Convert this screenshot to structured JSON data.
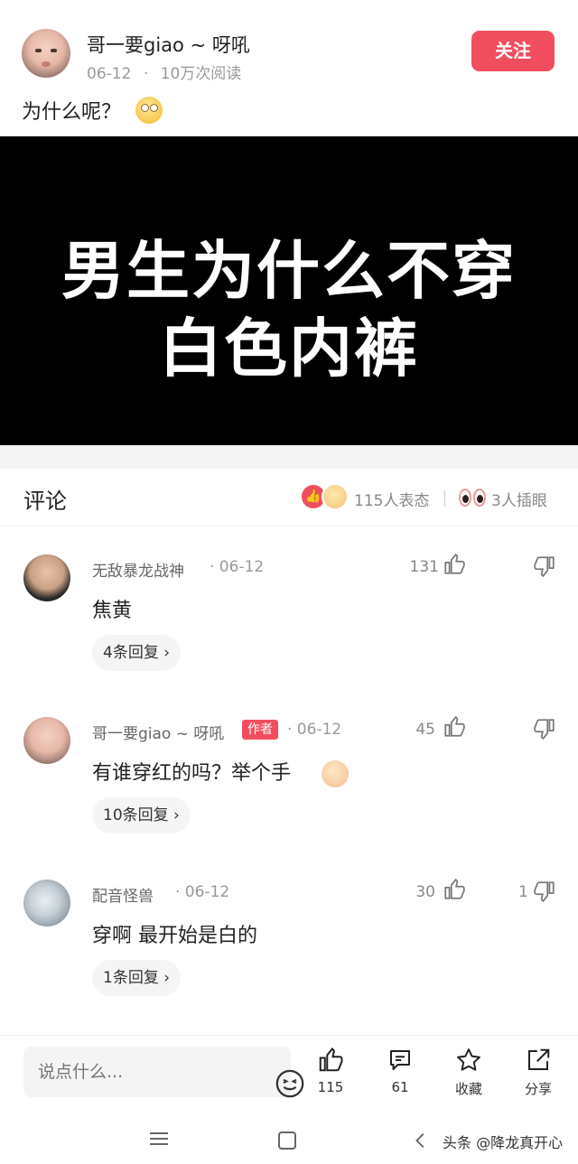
{
  "post": {
    "author": "哥一要giao ~ 呀吼",
    "date": "06-12",
    "meta_sep": "·",
    "reads": "10万次阅读",
    "follow_label": "关注",
    "text": "为什么呢？"
  },
  "video": {
    "title_line1": "男生为什么不穿",
    "title_line2": "白色内裤"
  },
  "comments_header": {
    "title": "评论",
    "reactions": "115人表态",
    "peek": "3人插眼"
  },
  "comments": [
    {
      "name": "无敌暴龙战神",
      "date": "· 06-12",
      "likes": "131",
      "dislikes": "",
      "text": "焦黄",
      "replies": "4条回复",
      "is_author": false
    },
    {
      "name": "哥一要giao ~ 呀吼",
      "badge": "作者",
      "date": "· 06-12",
      "likes": "45",
      "dislikes": "",
      "text": "有谁穿红的吗？举个手",
      "replies": "10条回复",
      "is_author": true
    },
    {
      "name": "配音怪兽",
      "date": "· 06-12",
      "likes": "30",
      "dislikes": "1",
      "text": "穿啊  最开始是白的",
      "replies": "1条回复",
      "is_author": false
    }
  ],
  "reply_chevron": "›",
  "bottom": {
    "input_placeholder": "说点什么...",
    "like_count": "115",
    "comment_count": "61",
    "favorite_label": "收藏",
    "share_label": "分享"
  },
  "watermark": "头条 @降龙真开心",
  "colors": {
    "accent": "#f04e5e",
    "text_primary": "#222222",
    "text_secondary": "#999999"
  },
  "icons": [
    "like-icon",
    "dislike-icon",
    "comment-icon",
    "star-icon",
    "share-icon",
    "emoji-icon",
    "menu-icon",
    "home-icon",
    "back-icon"
  ]
}
